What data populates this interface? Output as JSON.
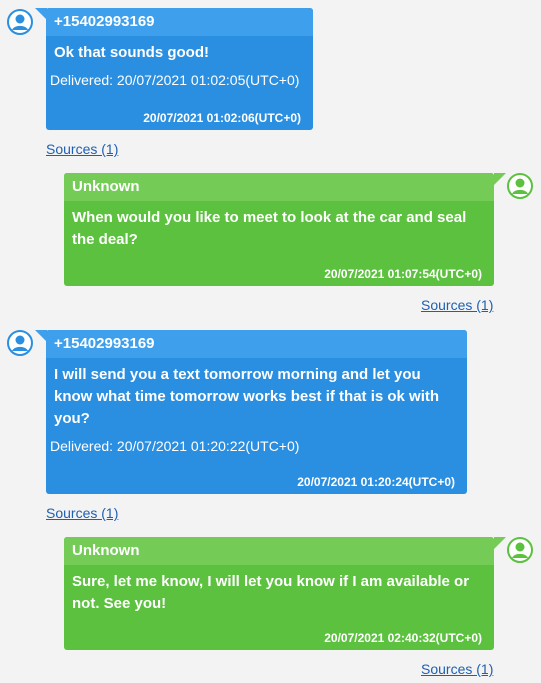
{
  "messages": [
    {
      "direction": "incoming",
      "sender": "+15402993169",
      "text": "Ok that sounds good!",
      "delivered": "Delivered: 20/07/2021 01:02:05(UTC+0)",
      "timestamp": "20/07/2021 01:02:06(UTC+0)",
      "sources": "Sources (1)"
    },
    {
      "direction": "outgoing",
      "sender": "Unknown",
      "text": "When would you like to meet to look at the car and seal the deal?",
      "timestamp": "20/07/2021 01:07:54(UTC+0)",
      "sources": "Sources (1)"
    },
    {
      "direction": "incoming",
      "sender": "+15402993169",
      "text": "I will send you a text tomorrow morning and let you know what time tomorrow works best if that is ok with you?",
      "delivered": "Delivered: 20/07/2021 01:20:22(UTC+0)",
      "timestamp": "20/07/2021 01:20:24(UTC+0)",
      "sources": "Sources (1)"
    },
    {
      "direction": "outgoing",
      "sender": "Unknown",
      "text": "Sure, let me know, I will let you know if I am available or not. See you!",
      "timestamp": "20/07/2021 02:40:32(UTC+0)",
      "sources": "Sources (1)"
    }
  ],
  "colors": {
    "incoming_bubble": "#2a8fe0",
    "incoming_header": "#3ea0ec",
    "outgoing_bubble": "#5cc13f",
    "outgoing_header": "#74cb56",
    "link": "#1f5fb0"
  },
  "icons": {
    "avatar": "person-avatar-icon"
  }
}
